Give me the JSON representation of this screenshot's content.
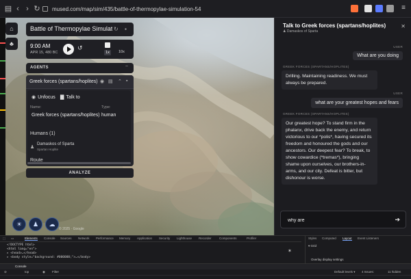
{
  "browser": {
    "url": "mused.com/map/sim/435/battle-of-thermopylae-simulation-54",
    "accent": "#ff7139"
  },
  "sim": {
    "title": "Battle of Thermopylae Simulation",
    "time": "9:00 AM",
    "date": "APR 15, 480 BC",
    "speed_options": [
      "1x",
      "10x"
    ],
    "agents_label": "AGENTS",
    "agent": {
      "name": "Greek forces (spartans/hoplites)",
      "actions": [
        "Unfocus",
        "Talk to"
      ],
      "name_label": "Name:",
      "name_value": "Greek forces (spartans/hoplites)",
      "type_label": "Type:",
      "type_value": "human",
      "humans_label": "Humans (1)",
      "human_name": "Damaskos of Sparta",
      "human_role": "Spartan Hoplite",
      "route_label": "Route"
    },
    "analyze_label": "ANALYZE"
  },
  "chat": {
    "title": "Talk to Greek forces (spartans/hoplites)",
    "subtitle": "Damaskos of Sparta",
    "user_label": "USER",
    "agent_label": "GREEK FORCES (SPARTANS/HOPLITES)",
    "messages": [
      {
        "from": "user",
        "text": "What are you doing"
      },
      {
        "from": "agent",
        "text": "Drilling. Maintaining readiness. We must always be prepared."
      },
      {
        "from": "user",
        "text": "what are your greatest hopes and fears"
      },
      {
        "from": "agent",
        "text": "Our greatest hope? To stand firm in the phalanx, drive back the enemy, and return victorious to our *polis*, having secured its freedom and honoured the gods and our ancestors. Our deepest fear? To break, to show cowardice (*tremas*), bringing shame upon ourselves, our brothers-in-arms, and our city. Defeat is bitter, but dishonour is worse."
      }
    ],
    "input_value": "why are"
  },
  "devtools": {
    "tabs": [
      "Elements",
      "Console",
      "Sources",
      "Network",
      "Performance",
      "Memory",
      "Application",
      "Security",
      "Lighthouse",
      "Recorder",
      "Components",
      "Profiler"
    ],
    "code": [
      "<!DOCTYPE html>",
      "<html lang=\"en\">",
      "▸ <head>…</head>",
      "▸ <body style=\"background: #000000;\">…</body>"
    ],
    "right_tabs": [
      "Styles",
      "Computed",
      "Layout",
      "Event Listeners"
    ],
    "grid_label": "▾ Grid",
    "overlay_label": "Overlay display settings",
    "console_label": "Console",
    "console_top": "top",
    "console_filter": "Filter",
    "console_levels": "Default levels ▾",
    "console_issues": "4 Issues:",
    "console_hidden": "11 hidden"
  }
}
